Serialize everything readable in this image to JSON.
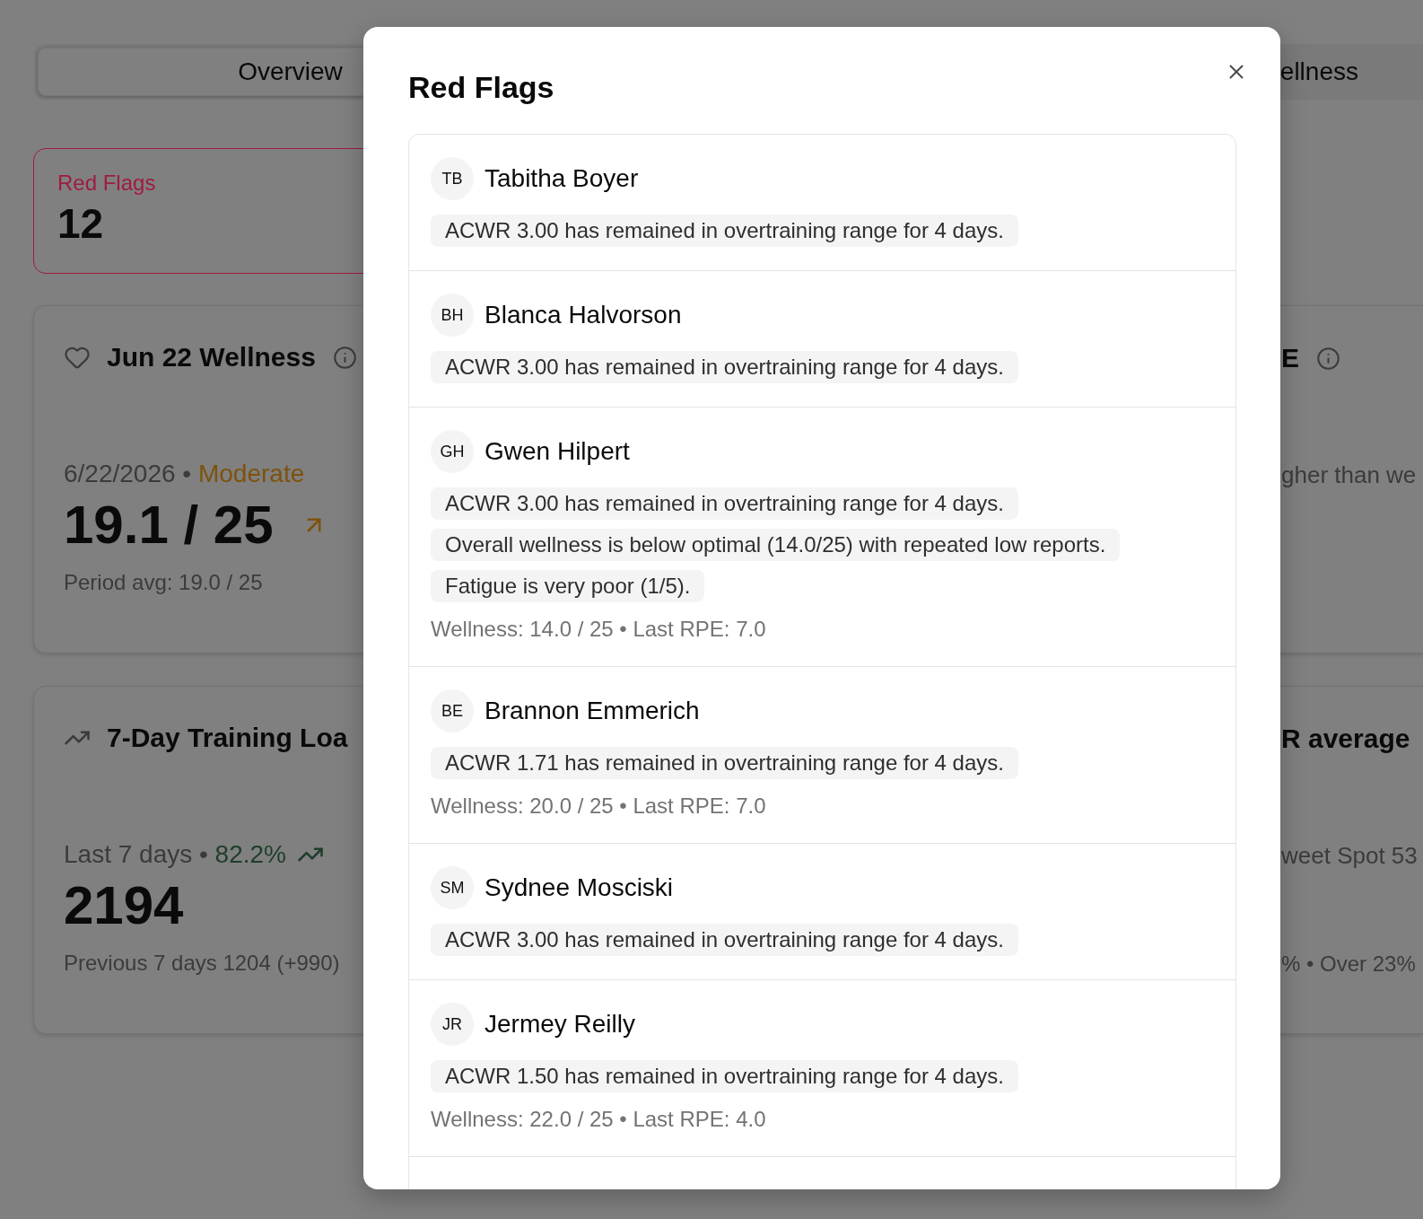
{
  "tabs": [
    {
      "label": "Overview",
      "selected": true
    },
    {
      "label": "ellness",
      "selected": false
    }
  ],
  "summary": {
    "label": "Red Flags",
    "value": "12"
  },
  "card_rows": [
    [
      {
        "kind": "wellness",
        "title": "Jun 22 Wellness",
        "subtitle": "6/22/2026",
        "separator": "•",
        "status": {
          "text": "Moderate",
          "color": "#7d520e"
        },
        "value": "19.1 / 25",
        "note": "Period avg: 19.0 / 25"
      },
      {
        "kind": "rpe",
        "title": "E",
        "subtitle": "gher than we"
      }
    ],
    [
      {
        "kind": "load",
        "title": "7-Day Training Loa",
        "subtitle": "Last 7 days",
        "separator": "•",
        "status": {
          "text": "82.2%",
          "color": "#1e3d29"
        },
        "value": "2194",
        "note": "Previous 7 days 1204 (+990)"
      },
      {
        "kind": "acwr",
        "title": "R average",
        "subtitle": "weet Spot 53",
        "note": "% • Over 23%"
      }
    ]
  ],
  "dialog": {
    "title": "Red Flags",
    "flags": [
      {
        "initials": "TB",
        "name": "Tabitha Boyer",
        "reasons": [
          "ACWR 3.00 has remained in overtraining range for 4 days."
        ]
      },
      {
        "initials": "BH",
        "name": "Blanca Halvorson",
        "reasons": [
          "ACWR 3.00 has remained in overtraining range for 4 days."
        ]
      },
      {
        "initials": "GH",
        "name": "Gwen Hilpert",
        "reasons": [
          "ACWR 3.00 has remained in overtraining range for 4 days.",
          "Overall wellness is below optimal (14.0/25) with repeated low reports.",
          "Fatigue is very poor (1/5)."
        ],
        "stats": "Wellness: 14.0 / 25 • Last RPE: 7.0"
      },
      {
        "initials": "BE",
        "name": "Brannon Emmerich",
        "reasons": [
          "ACWR 1.71 has remained in overtraining range for 4 days."
        ],
        "stats": "Wellness: 20.0 / 25 • Last RPE: 7.0"
      },
      {
        "initials": "SM",
        "name": "Sydnee Mosciski",
        "reasons": [
          "ACWR 3.00 has remained in overtraining range for 4 days."
        ]
      },
      {
        "initials": "JR",
        "name": "Jermey Reilly",
        "reasons": [
          "ACWR 1.50 has remained in overtraining range for 4 days."
        ],
        "stats": "Wellness: 22.0 / 25 • Last RPE: 4.0"
      }
    ]
  }
}
